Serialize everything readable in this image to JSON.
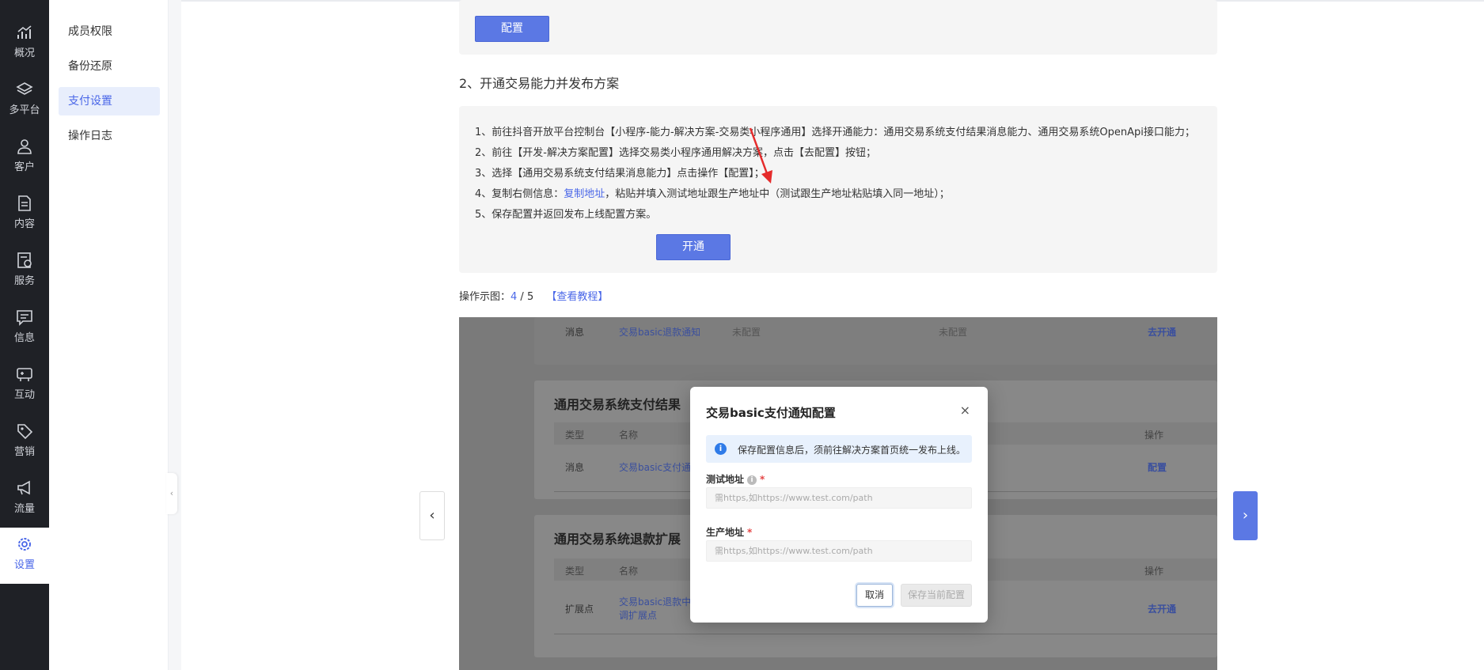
{
  "rail": {
    "items": [
      {
        "label": "概况",
        "icon": "chart-trend-icon"
      },
      {
        "label": "多平台",
        "icon": "layers-icon"
      },
      {
        "label": "客户",
        "icon": "user-icon"
      },
      {
        "label": "内容",
        "icon": "document-icon"
      },
      {
        "label": "服务",
        "icon": "service-doc-icon"
      },
      {
        "label": "信息",
        "icon": "message-icon"
      },
      {
        "label": "互动",
        "icon": "gamepad-icon"
      },
      {
        "label": "营销",
        "icon": "tag-icon"
      },
      {
        "label": "流量",
        "icon": "megaphone-icon"
      },
      {
        "label": "设置",
        "icon": "gear-icon"
      }
    ],
    "active_index": 9,
    "accent": "#4a67e8"
  },
  "subnav": {
    "items": [
      "成员权限",
      "备份还原",
      "支付设置",
      "操作日志"
    ],
    "active_index": 2
  },
  "top_card": {
    "button": "配置"
  },
  "section": {
    "heading": "2、开通交易能力并发布方案",
    "steps": [
      "1、前往抖音开放平台控制台【小程序-能力-解决方案-交易类小程序通用】选择开通能力：通用交易系统支付结果消息能力、通用交易系统OpenApi接口能力；",
      "2、前往【开发-解决方案配置】选择交易类小程序通用解决方案，点击【去配置】按钮；",
      "3、选择【通用交易系统支付结果消息能力】点击操作【配置】；",
      "5、保存配置并返回发布上线配置方案。"
    ],
    "step4_prefix": "4、复制右侧信息：",
    "step4_link": "复制地址",
    "step4_suffix": "，粘贴并填入测试地址跟生产地址中（测试跟生产地址粘贴填入同一地址）；",
    "open_button": "开通"
  },
  "demo": {
    "label": "操作示图：",
    "current": "4",
    "sep": " / ",
    "total": "5",
    "tutorial_link": "【查看教程】"
  },
  "shot": {
    "row1": {
      "type": "消息",
      "name": "交易basic退款通知",
      "col3": "未配置",
      "col4": "未配置",
      "action": "去开通"
    },
    "card1": {
      "title": "通用交易系统支付结果",
      "col_type": "类型",
      "col_name": "名称",
      "col_action": "操作",
      "row_type": "消息",
      "row_name": "交易basic支付通",
      "row_action": "配置"
    },
    "card2": {
      "title": "通用交易系统退款扩展",
      "col_type": "类型",
      "col_name": "名称",
      "col_action": "操作",
      "row_type": "扩展点",
      "row_name_1": "交易basic退款中",
      "row_name_2": "调扩展点",
      "row_action": "去开通"
    }
  },
  "modal": {
    "title": "交易basic支付通知配置",
    "close": "×",
    "alert": "保存配置信息后，须前往解决方案首页统一发布上线。",
    "test_label": "测试地址",
    "prod_label": "生产地址",
    "required_mark": "*",
    "info_mark": "i",
    "alert_mark": "i",
    "placeholder": "需https,如https://www.test.com/path",
    "cancel": "取消",
    "save": "保存当前配置"
  },
  "nav": {
    "prev": "‹",
    "next": "›"
  }
}
